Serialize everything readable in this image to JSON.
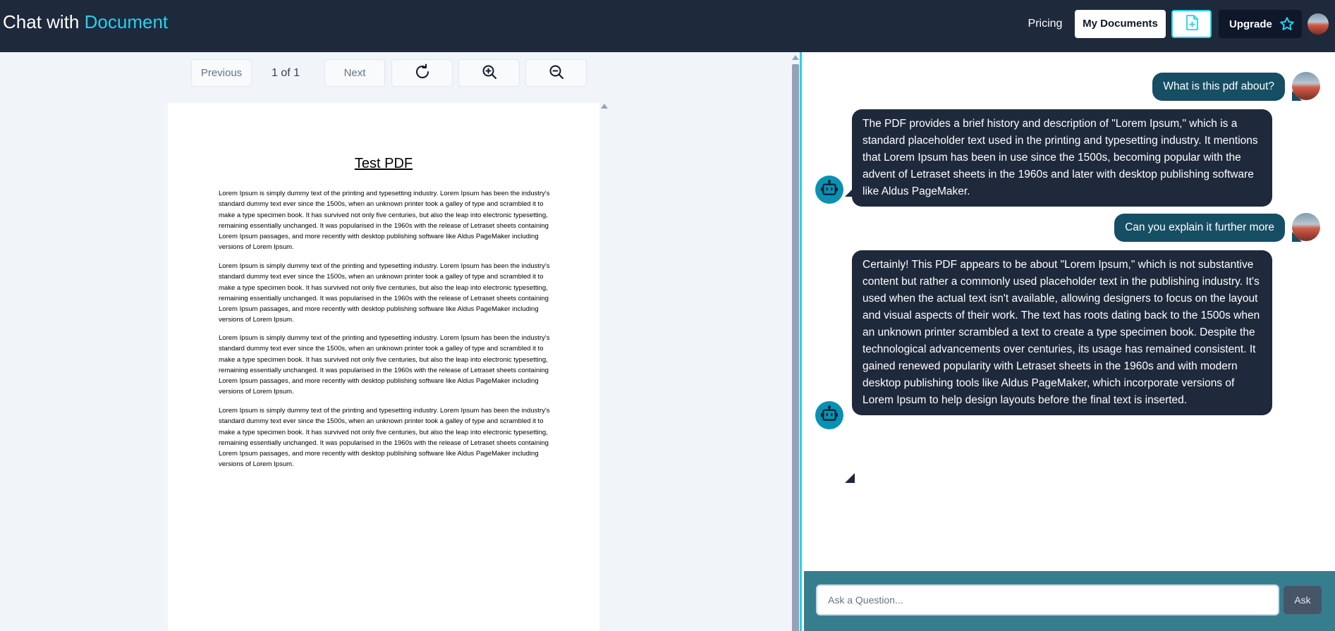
{
  "header": {
    "brand_prefix": "Chat with",
    "brand_accent": "Document",
    "pricing_label": "Pricing",
    "my_documents_label": "My Documents",
    "upgrade_label": "Upgrade"
  },
  "pdf_toolbar": {
    "previous_label": "Previous",
    "page_indicator": "1 of 1",
    "next_label": "Next"
  },
  "pdf": {
    "title": "Test PDF",
    "paragraphs": [
      "Lorem Ipsum is simply dummy text of the printing and typesetting industry. Lorem Ipsum has been the industry's standard dummy text ever since the 1500s, when an unknown printer took a galley of type and scrambled it to make a type specimen book. It has survived not only five centuries, but also the leap into electronic typesetting, remaining essentially unchanged. It was popularised in the 1960s with the release of Letraset sheets containing Lorem Ipsum passages, and more recently with desktop publishing software like Aldus PageMaker including versions of Lorem Ipsum.",
      "Lorem Ipsum is simply dummy text of the printing and typesetting industry. Lorem Ipsum has been the industry's standard dummy text ever since the 1500s, when an unknown printer took a galley of type and scrambled it to make a type specimen book. It has survived not only five centuries, but also the leap into electronic typesetting, remaining essentially unchanged. It was popularised in the 1960s with the release of Letraset sheets containing Lorem Ipsum passages, and more recently with desktop publishing software like Aldus PageMaker including versions of Lorem Ipsum.",
      "Lorem Ipsum is simply dummy text of the printing and typesetting industry. Lorem Ipsum has been the industry's standard dummy text ever since the 1500s, when an unknown printer took a galley of type and scrambled it to make a type specimen book. It has survived not only five centuries, but also the leap into electronic typesetting, remaining essentially unchanged. It was popularised in the 1960s with the release of Letraset sheets containing Lorem Ipsum passages, and more recently with desktop publishing software like Aldus PageMaker including versions of Lorem Ipsum.",
      "Lorem Ipsum is simply dummy text of the printing and typesetting industry. Lorem Ipsum has been the industry's standard dummy text ever since the 1500s, when an unknown printer took a galley of type and scrambled it to make a type specimen book. It has survived not only five centuries, but also the leap into electronic typesetting, remaining essentially unchanged. It was popularised in the 1960s with the release of Letraset sheets containing Lorem Ipsum passages, and more recently with desktop publishing software like Aldus PageMaker including versions of Lorem Ipsum."
    ]
  },
  "chat": {
    "messages": [
      {
        "role": "user",
        "text": "What is this pdf about?"
      },
      {
        "role": "bot",
        "text": "The PDF provides a brief history and description of \"Lorem Ipsum,\" which is a standard placeholder text used in the printing and typesetting industry. It mentions that Lorem Ipsum has been in use since the 1500s, becoming popular with the advent of Letraset sheets in the 1960s and later with desktop publishing software like Aldus PageMaker."
      },
      {
        "role": "user",
        "text": "Can you explain it further more"
      },
      {
        "role": "bot",
        "text": "Certainly! This PDF appears to be about \"Lorem Ipsum,\" which is not substantive content but rather a commonly used placeholder text in the publishing industry. It's used when the actual text isn't available, allowing designers to focus on the layout and visual aspects of their work. The text has roots dating back to the 1500s when an unknown printer scrambled a text to create a type specimen book. Despite the technological advancements over centuries, its usage has remained consistent. It gained renewed popularity with Letraset sheets in the 1960s and with modern desktop publishing tools like Aldus PageMaker, which incorporate versions of Lorem Ipsum to help design layouts before the final text is inserted."
      }
    ],
    "input_placeholder": "Ask a Question...",
    "ask_label": "Ask"
  },
  "icons": {
    "upload": "file-plus-icon",
    "upgrade": "star-icon",
    "rotate": "refresh-icon",
    "zoom_in": "zoom-in-icon",
    "zoom_out": "zoom-out-icon",
    "bot": "robot-icon"
  },
  "colors": {
    "header_bg": "#1e293b",
    "accent": "#22d3ee",
    "user_bubble": "#164e63",
    "bot_bubble": "#1e293b",
    "input_bar": "#367e8e"
  }
}
